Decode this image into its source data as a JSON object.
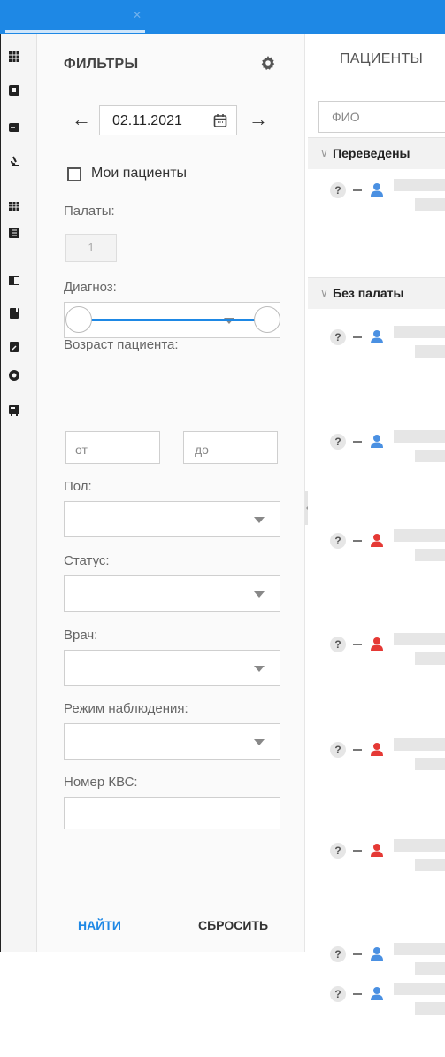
{
  "filters": {
    "title": "ФИЛЬТРЫ",
    "date": "02.11.2021",
    "my_patients_label": "Мои пациенты",
    "rooms_label": "Палаты:",
    "room_value": "1",
    "diagnosis_label": "Диагноз:",
    "age_label": "Возраст пациента:",
    "age_from_placeholder": "от",
    "age_to_placeholder": "до",
    "sex_label": "Пол:",
    "status_label": "Статус:",
    "doctor_label": "Врач:",
    "observation_label": "Режим наблюдения:",
    "kvs_label": "Номер КВС:",
    "find_button": "НАЙТИ",
    "reset_button": "СБРОСИТЬ"
  },
  "patients": {
    "title": "ПАЦИЕНТЫ",
    "search_placeholder": "ФИО",
    "groups": [
      {
        "label": "Переведены"
      },
      {
        "label": "Без палаты"
      }
    ],
    "row_status_symbol": "?",
    "rows": [
      {
        "sex": "male"
      },
      {
        "sex": "male"
      },
      {
        "sex": "male"
      },
      {
        "sex": "female"
      },
      {
        "sex": "female"
      },
      {
        "sex": "female"
      },
      {
        "sex": "female"
      },
      {
        "sex": "male"
      },
      {
        "sex": "male"
      }
    ]
  },
  "colors": {
    "accent": "#1e88e5",
    "male_icon": "#4a90e2",
    "female_icon": "#e53935"
  }
}
